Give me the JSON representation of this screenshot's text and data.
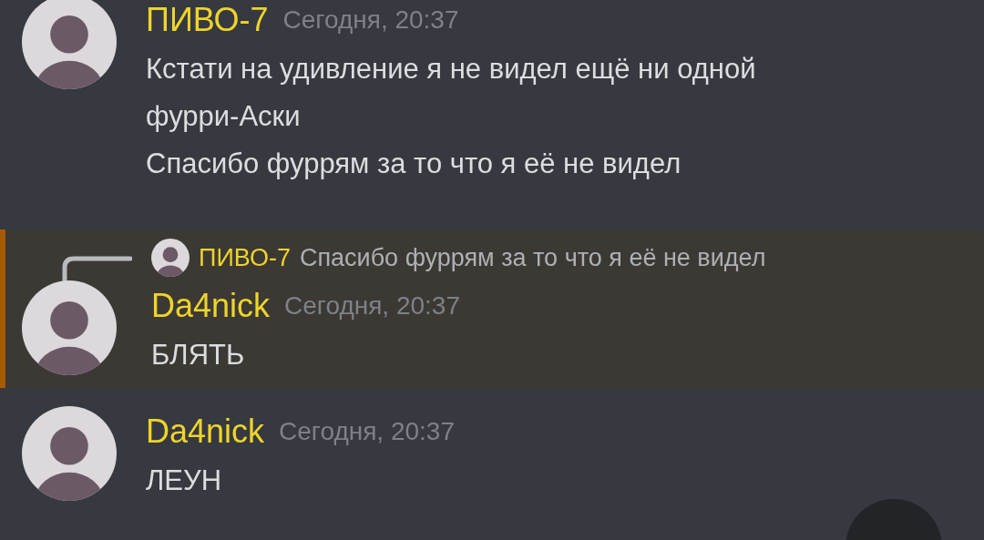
{
  "messages": [
    {
      "author": "ПИВО-7",
      "timestamp": "Сегодня, 20:37",
      "highlighted": false,
      "paragraphs": [
        "Кстати на удивление я не видел ещё ни одной фурри-Аски",
        "Спасибо фуррям за то что я её не видел"
      ]
    },
    {
      "author": "Da4nick",
      "timestamp": "Сегодня, 20:37",
      "highlighted": true,
      "reply": {
        "author": "ПИВО-7",
        "text": "Спасибо фуррям за то что я её не видел"
      },
      "paragraphs": [
        "БЛЯТЬ"
      ]
    },
    {
      "author": "Da4nick",
      "timestamp": "Сегодня, 20:37",
      "highlighted": false,
      "paragraphs": [
        "ЛЕУН"
      ]
    }
  ]
}
